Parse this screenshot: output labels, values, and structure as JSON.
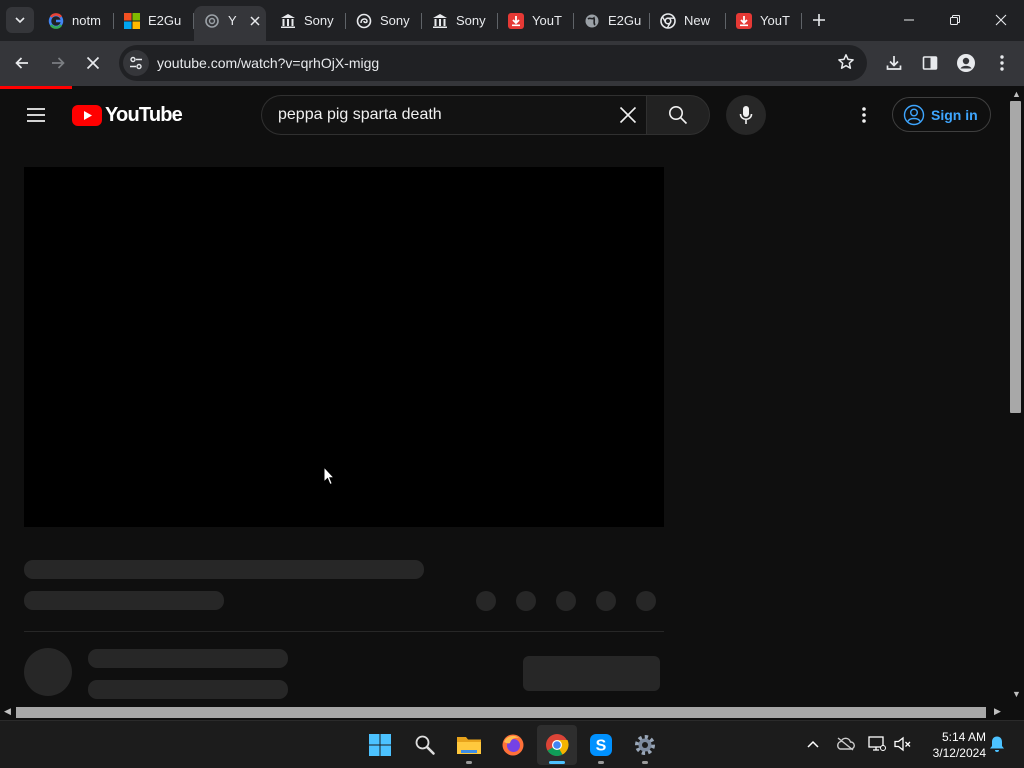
{
  "browser": {
    "tabs": [
      {
        "title": "notm",
        "icon": "google-g-icon"
      },
      {
        "title": "E2Gu",
        "icon": "microsoft-icon"
      },
      {
        "title": "Y",
        "icon": "loading-icon",
        "active": true
      },
      {
        "title": "Sony",
        "icon": "bank-icon"
      },
      {
        "title": "Sony",
        "icon": "swirl-icon"
      },
      {
        "title": "Sony",
        "icon": "bank-icon"
      },
      {
        "title": "YouT",
        "icon": "download-red-icon"
      },
      {
        "title": "E2Gu",
        "icon": "globe-icon"
      },
      {
        "title": "New",
        "icon": "chrome-icon"
      },
      {
        "title": "YouT",
        "icon": "download-red-icon"
      }
    ],
    "url": "youtube.com/watch?v=qrhOjX-migg",
    "load_progress": 0.07
  },
  "youtube": {
    "logo_text": "YouTube",
    "search_query": "peppa pig sparta death",
    "sign_in_label": "Sign in"
  },
  "taskbar": {
    "time": "5:14 AM",
    "date": "3/12/2024"
  },
  "colors": {
    "youtube_red": "#ff0000",
    "link_blue": "#3ea6ff",
    "background": "#0f0f0f",
    "skeleton": "#272727"
  }
}
